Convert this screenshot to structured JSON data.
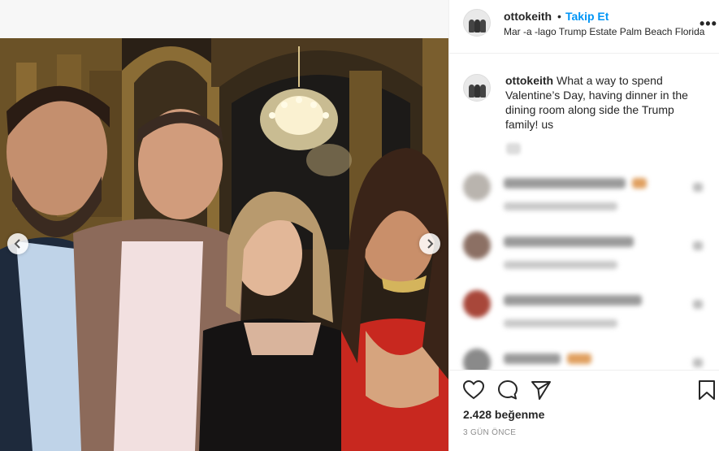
{
  "post": {
    "username": "ottokeith",
    "dot": "•",
    "follow_label": "Takip Et",
    "location": "Mar -a -lago Trump Estate Palm Beach Florida",
    "more_label": "•••",
    "caption_user": "ottokeith",
    "caption_text": " What a way to spend Valentine’s Day, having dinner in the dining room along side the Trump family! us",
    "likes": "2.428 beğenme",
    "time": "3 GÜN ÖNCE"
  },
  "carousel": {
    "prev_icon": "chevron-left-icon",
    "next_icon": "chevron-right-icon"
  },
  "actions": {
    "like_icon": "heart-icon",
    "comment_icon": "comment-icon",
    "share_icon": "send-icon",
    "save_icon": "bookmark-icon"
  },
  "colors": {
    "link_blue": "#0095f6",
    "text": "#262626",
    "muted": "#8e8e8e",
    "divider": "#efefef"
  }
}
